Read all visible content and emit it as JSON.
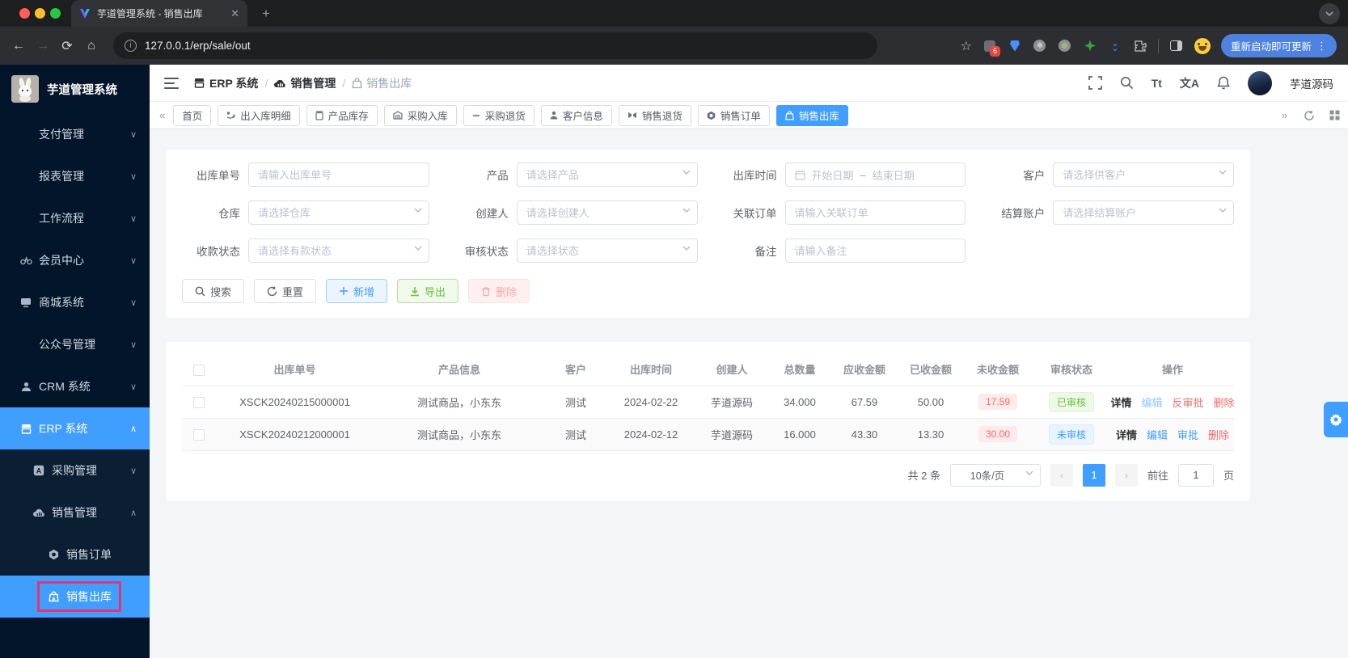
{
  "browser": {
    "tab_title": "芋道管理系统 - 销售出库",
    "url": "127.0.0.1/erp/sale/out",
    "url_info": "i",
    "extension_badge": "6",
    "update_button": "重新启动即可更新",
    "new_tab": "+",
    "close_tab": "✕"
  },
  "sidebar": {
    "logo_title": "芋道管理系统",
    "items": [
      {
        "label": "支付管理"
      },
      {
        "label": "报表管理"
      },
      {
        "label": "工作流程"
      },
      {
        "label": "会员中心"
      },
      {
        "label": "商城系统"
      },
      {
        "label": "公众号管理"
      },
      {
        "label": "CRM 系统"
      },
      {
        "label": "ERP 系统"
      }
    ],
    "submenu": [
      {
        "label": "采购管理"
      },
      {
        "label": "销售管理"
      },
      {
        "label": "销售订单"
      },
      {
        "label": "销售出库"
      }
    ]
  },
  "header": {
    "breadcrumb": {
      "crumb1": "ERP 系统",
      "crumb2": "销售管理",
      "crumb3": "销售出库"
    },
    "font_icon": "Tt",
    "lang_icon": "文A",
    "username": "芋道源码"
  },
  "tabbar": {
    "collapse_left": "«",
    "collapse_right": "»",
    "tabs": [
      {
        "label": "首页"
      },
      {
        "label": "出入库明细"
      },
      {
        "label": "产品库存"
      },
      {
        "label": "采购入库"
      },
      {
        "label": "采购退货"
      },
      {
        "label": "客户信息"
      },
      {
        "label": "销售退货"
      },
      {
        "label": "销售订单"
      },
      {
        "label": "销售出库"
      }
    ]
  },
  "filters": {
    "f1": {
      "label": "出库单号",
      "placeholder": "请输入出库单号"
    },
    "f2": {
      "label": "产品",
      "placeholder": "请选择产品"
    },
    "f3": {
      "label": "出库时间",
      "start": "开始日期",
      "separator": "–",
      "end": "结束日期"
    },
    "f4": {
      "label": "客户",
      "placeholder": "请选择供客户"
    },
    "f5": {
      "label": "仓库",
      "placeholder": "请选择仓库"
    },
    "f6": {
      "label": "创建人",
      "placeholder": "请选择创建人"
    },
    "f7": {
      "label": "关联订单",
      "placeholder": "请输入关联订单"
    },
    "f8": {
      "label": "结算账户",
      "placeholder": "请选择结算账户"
    },
    "f9": {
      "label": "收款状态",
      "placeholder": "请选择有款状态"
    },
    "f10": {
      "label": "审核状态",
      "placeholder": "请选择状态"
    },
    "f11": {
      "label": "备注",
      "placeholder": "请输入备注"
    }
  },
  "actions": {
    "search": "搜索",
    "reset": "重置",
    "add": "新增",
    "export": "导出",
    "delete": "删除"
  },
  "table": {
    "columns": {
      "c1": "出库单号",
      "c2": "产品信息",
      "c3": "客户",
      "c4": "出库时间",
      "c5": "创建人",
      "c6": "总数量",
      "c7": "应收金额",
      "c8": "已收金额",
      "c9": "未收金额",
      "c10": "审核状态",
      "c11": "操作"
    },
    "rows": [
      {
        "order_no": "XSCK20240215000001",
        "product": "测试商品，小东东",
        "customer": "测试",
        "date": "2024-02-22",
        "creator": "芋道源码",
        "qty": "34.000",
        "receivable": "67.59",
        "received": "50.00",
        "unreceived": "17.59",
        "status": "已审核",
        "op1": "详情",
        "op2": "编辑",
        "op3": "反审批",
        "op4": "删除"
      },
      {
        "order_no": "XSCK20240212000001",
        "product": "测试商品，小东东",
        "customer": "测试",
        "date": "2024-02-12",
        "creator": "芋道源码",
        "qty": "16.000",
        "receivable": "43.30",
        "received": "13.30",
        "unreceived": "30.00",
        "status": "未审核",
        "op1": "详情",
        "op2": "编辑",
        "op3": "审批",
        "op4": "删除"
      }
    ]
  },
  "pagination": {
    "total": "共 2 条",
    "page_size": "10条/页",
    "current_page": "1",
    "goto_label": "前往",
    "goto_value": "1",
    "page_unit": "页"
  },
  "colors": {
    "primary": "#409eff",
    "success": "#67c23a",
    "danger": "#f56c6c",
    "sidebar_bg": "#02152a",
    "annotation": "#e8336e"
  }
}
